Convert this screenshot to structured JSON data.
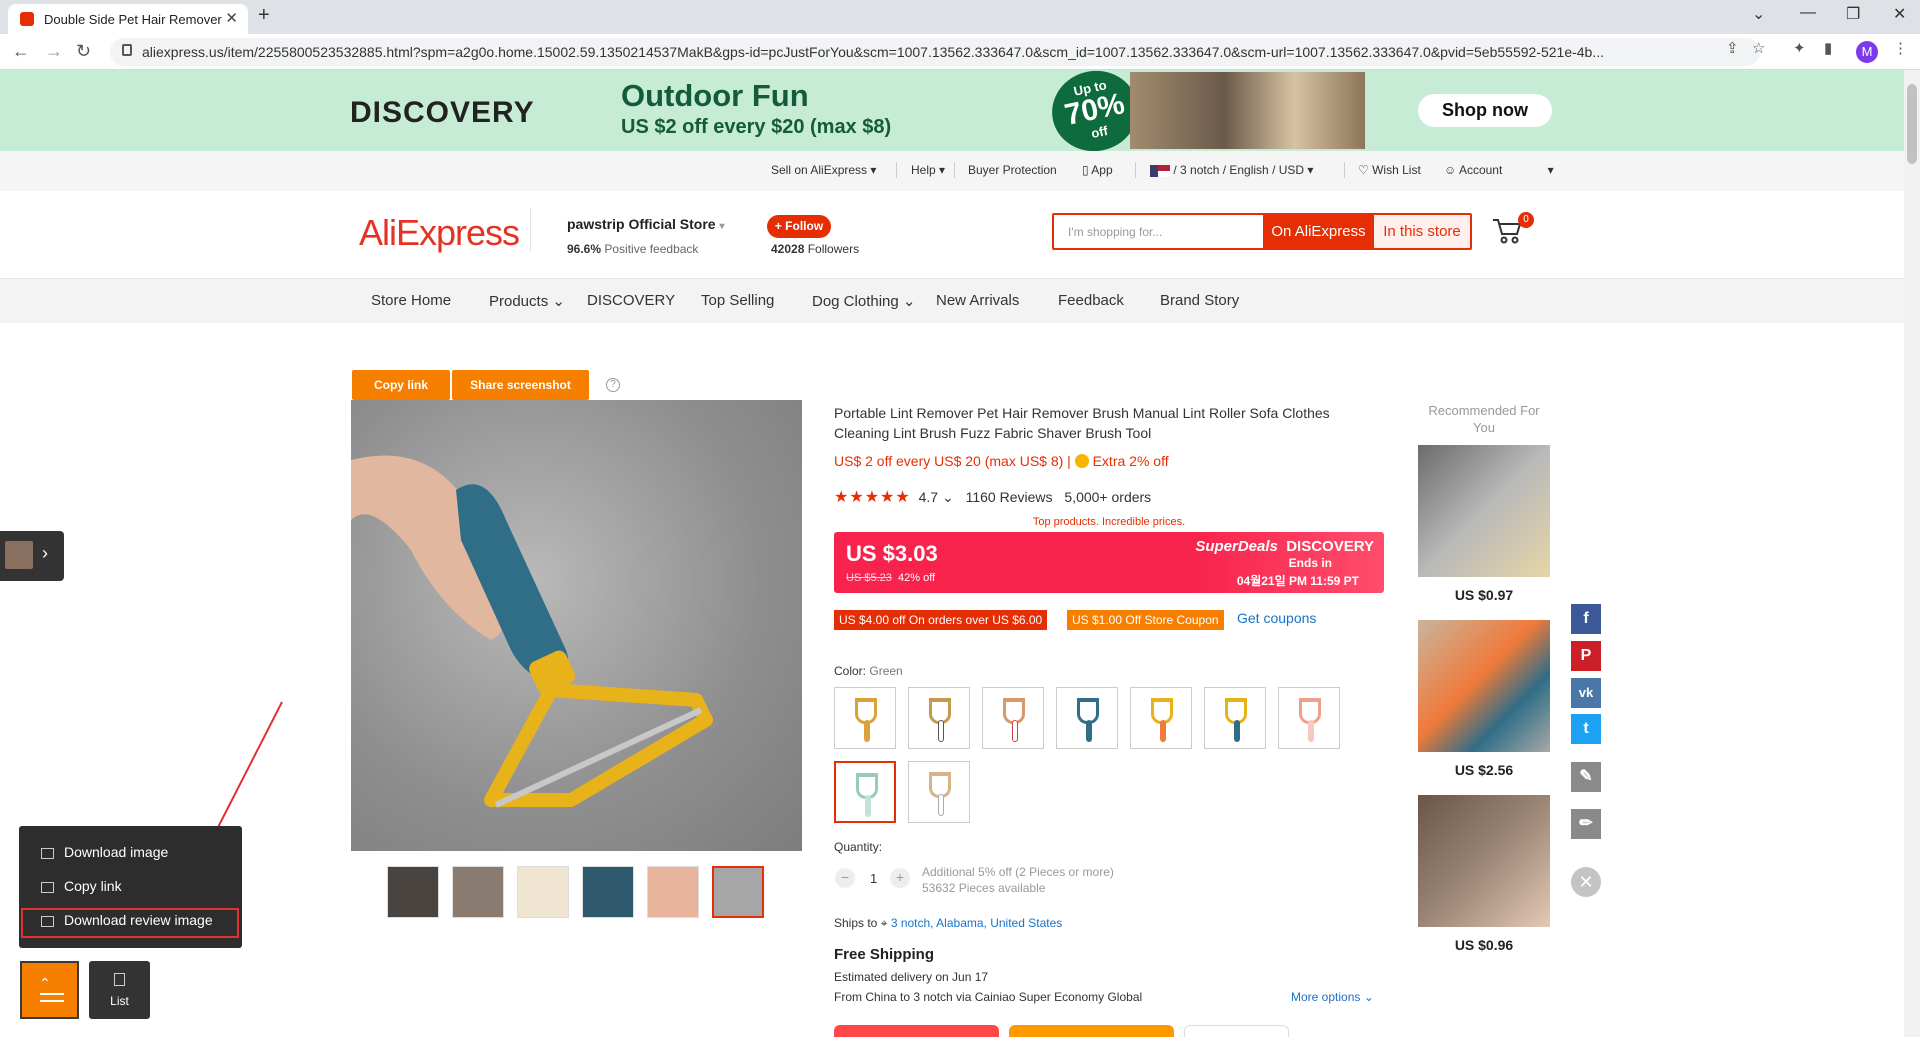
{
  "browser": {
    "tab_title": "Double Side Pet Hair Remover",
    "url": "aliexpress.us/item/2255800523532885.html?spm=a2g0o.home.15002.59.1350214537MakB&gps-id=pcJustForYou&scm=1007.13562.333647.0&scm_id=1007.13562.333647.0&scm-url=1007.13562.333647.0&pvid=5eb55592-521e-4b...",
    "profile_initial": "M"
  },
  "banner": {
    "brand": "DISCOVERY",
    "headline": "Outdoor Fun",
    "subline": "US $2 off every $20 (max $8)",
    "badge_up": "Up to",
    "badge_pct": "70%",
    "badge_off": "off",
    "cta": "Shop now"
  },
  "toplinks": {
    "sell": "Sell on AliExpress",
    "help": "Help",
    "buyer": "Buyer Protection",
    "app": "App",
    "locale": "/ 3 notch / English / USD",
    "wishlist": "Wish List",
    "account": "Account"
  },
  "store": {
    "logo": "AliExpress",
    "name": "pawstrip Official Store",
    "positive_pct": "96.6%",
    "positive_label": "Positive feedback",
    "follow": "+ Follow",
    "followers_count": "42028",
    "followers_label": "Followers",
    "search_placeholder": "I'm shopping for...",
    "btn_ali": "On AliExpress",
    "btn_store": "In this store",
    "cart_count": "0"
  },
  "storenav": [
    "Store Home",
    "Products",
    "DISCOVERY",
    "Top Selling",
    "Dog Clothing",
    "New Arrivals",
    "Feedback",
    "Brand Story"
  ],
  "product": {
    "copy_link": "Copy link",
    "share_screenshot": "Share screenshot",
    "help_mark": "?",
    "title": "Portable Lint Remover Pet Hair Remover Brush Manual Lint Roller Sofa Clothes Cleaning Lint Brush Fuzz Fabric Shaver Brush Tool",
    "promo": "US$ 2 off every US$ 20 (max US$ 8) |",
    "extra": "Extra 2% off",
    "stars": "★★★★★",
    "rating": "4.7",
    "reviews": "1160 Reviews",
    "orders": "5,000+ orders",
    "top_products": "Top products. Incredible prices.",
    "price": "US $3.03",
    "old_price": "US $5.23",
    "discount": "42% off",
    "superdeals": "SuperDeals",
    "discovery": "DISCOVERY",
    "ends_in": "Ends in",
    "end_date": "04월21일 PM 11:59 PT",
    "coupon1": "US $4.00 off On orders over US $6.00",
    "coupon2": "US $1.00 Off Store Coupon",
    "get_coupons": "Get coupons",
    "color_label": "Color:",
    "color_value": "Green",
    "quantity_label": "Quantity:",
    "qty_minus": "−",
    "qty_plus": "+",
    "qty": "1",
    "qty_note1": "Additional 5% off (2 Pieces or more)",
    "qty_note2": "53632 Pieces available",
    "ships_to_label": "Ships to",
    "ships_to": "3 notch, Alabama, United States",
    "free_shipping": "Free Shipping",
    "delivery": "Estimated delivery on Jun 17",
    "from": "From China to 3 notch via Cainiao Super Economy Global",
    "more_options": "More options"
  },
  "recommended": {
    "title": "Recommended For You",
    "prices": [
      "US $0.97",
      "US $2.56",
      "US $0.96"
    ]
  },
  "social": [
    "f",
    "P",
    "vk",
    "t"
  ],
  "widget": {
    "menu": [
      "Download image",
      "Copy link",
      "Download review image"
    ],
    "list_label": "List"
  },
  "colors": {
    "accent": "#e62e04",
    "orange": "#f77f00",
    "price_red": "#f8234d"
  }
}
